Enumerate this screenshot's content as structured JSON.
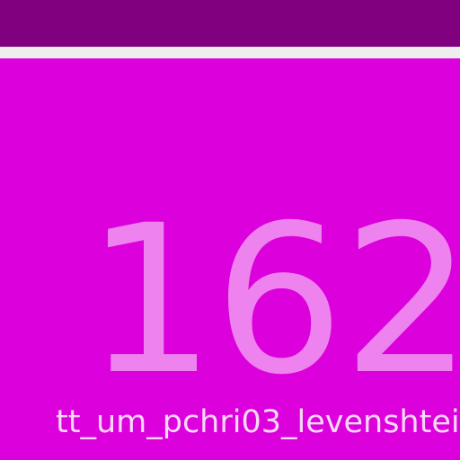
{
  "colors": {
    "status_bar": "#800080",
    "divider": "#EEEEEE",
    "background": "#DC00DC",
    "number_text": "#EE82EE",
    "title_text": "#F8D8F8"
  },
  "main": {
    "value": "162",
    "title": "tt_um_pchri03_levenshtei"
  }
}
